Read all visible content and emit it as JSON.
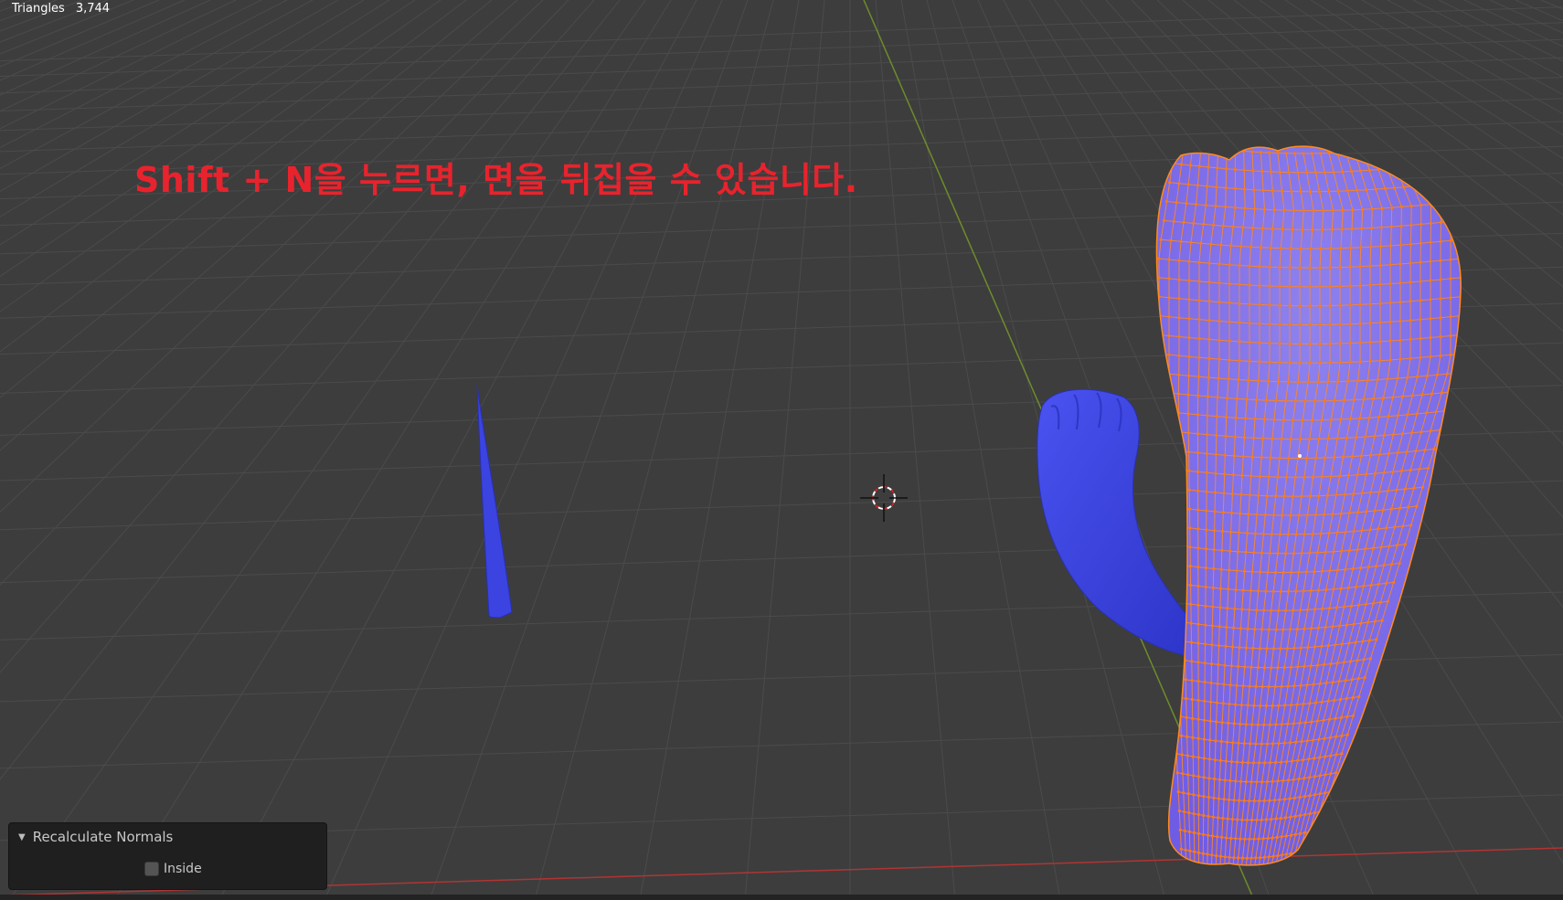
{
  "stats": {
    "label": "Triangles",
    "value": "3,744"
  },
  "overlay_text": "Shift + N을 누르면, 면을 뒤집을 수 있습니다.",
  "operator_panel": {
    "title": "Recalculate Normals",
    "collapse_icon": "triangle-down-icon",
    "options": [
      {
        "label": "Inside",
        "checked": false
      }
    ]
  },
  "colors": {
    "background": "#3d3d3d",
    "grid": "#4d4d4d",
    "x_axis": "#b13434",
    "y_axis": "#6e8c2b",
    "mesh_fill": "#7a66e8",
    "mesh_wire": "#ff8a1f",
    "object_blue": "#3b44e0",
    "overlay_text": "#e8232d"
  },
  "icons": [
    "3d-cursor-icon"
  ]
}
